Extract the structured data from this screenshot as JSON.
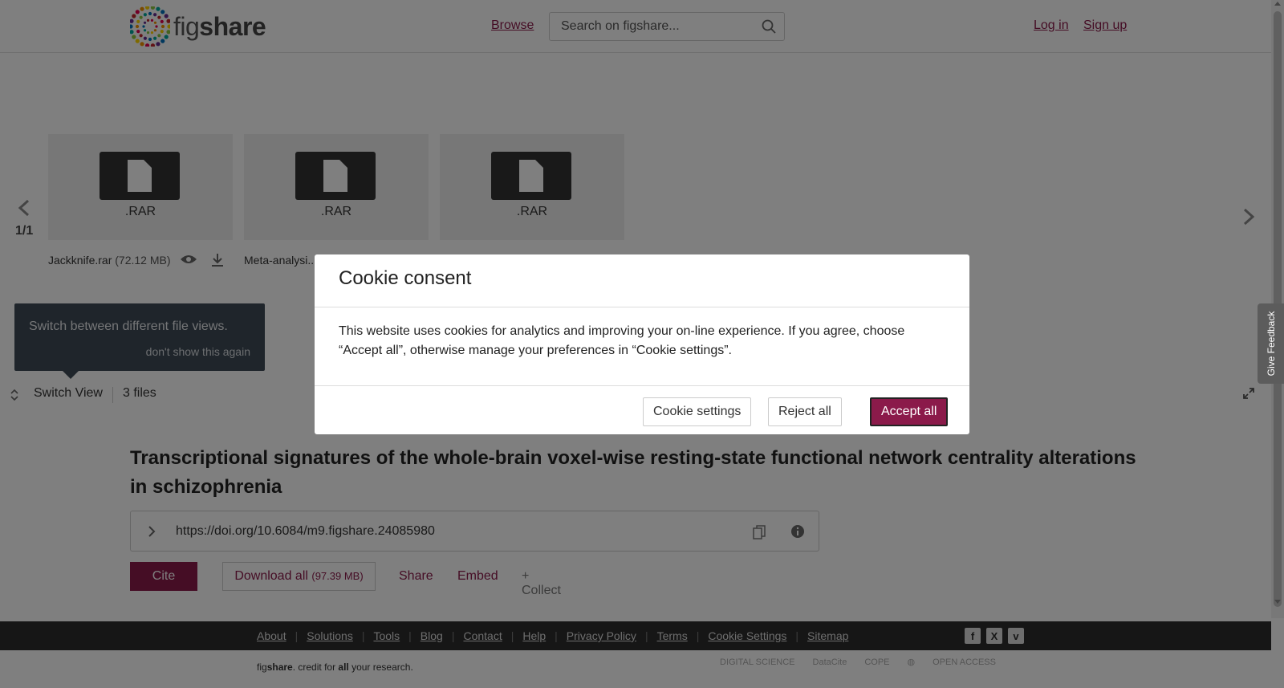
{
  "header": {
    "logo_text_light": "fig",
    "logo_text_bold": "share",
    "browse": "Browse",
    "search_placeholder": "Search on figshare...",
    "login": "Log in",
    "signup": "Sign up"
  },
  "viewer": {
    "pager": "1/1",
    "files": [
      {
        "ext": ".RAR",
        "name": "Jackknife.rar",
        "size": "(72.12 MB)"
      },
      {
        "ext": ".RAR",
        "name": "Meta-analysi...",
        "size": ""
      },
      {
        "ext": ".RAR",
        "name": "",
        "size": ""
      }
    ],
    "tooltip_text": "Switch between different file views.",
    "tooltip_dismiss": "don't show this again",
    "switch_view": "Switch View",
    "files_count": "3 files"
  },
  "feedback": "Give Feedback",
  "item": {
    "title": "Transcriptional signatures of the whole-brain voxel-wise resting-state functional network centrality alterations in schizophrenia",
    "doi": "https://doi.org/10.6084/m9.figshare.24085980",
    "cite": "Cite",
    "download_all": "Download all",
    "download_size": "(97.39 MB)",
    "share": "Share",
    "embed": "Embed",
    "collect": "+ Collect"
  },
  "footer": {
    "links": [
      "About",
      "Solutions",
      "Tools",
      "Blog",
      "Contact",
      "Help",
      "Privacy Policy",
      "Terms",
      "Cookie Settings",
      "Sitemap"
    ],
    "tagline_1": "fig",
    "tagline_2": "share",
    "tagline_3": ". credit for ",
    "tagline_4": "all",
    "tagline_5": " your research.",
    "partners": [
      "DIGITAL SCIENCE",
      "DataCite",
      "COPE",
      "OPEN ACCESS"
    ]
  },
  "cookie": {
    "title": "Cookie consent",
    "body": "This website uses cookies for analytics and improving your on-line experience. If you agree, choose “Accept all”, otherwise manage your preferences in “Cookie settings”.",
    "settings": "Cookie settings",
    "reject": "Reject all",
    "accept": "Accept all"
  },
  "colors": {
    "brand": "#8b1a4a",
    "footer_bg": "#2d2d2d"
  }
}
